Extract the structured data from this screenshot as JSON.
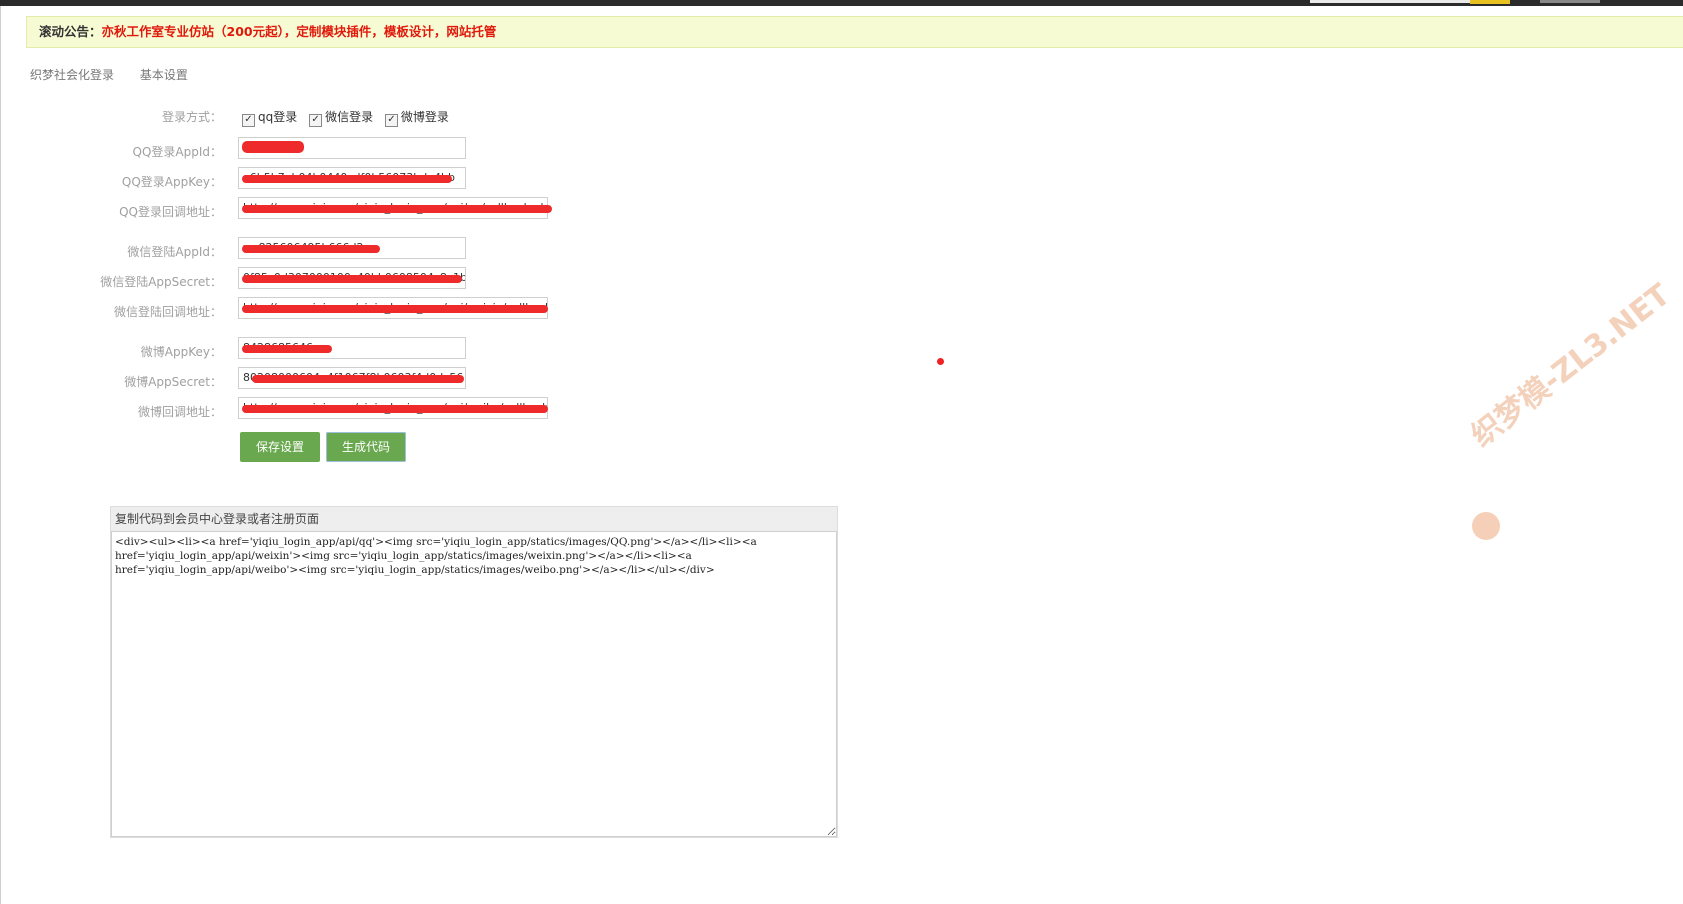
{
  "notice": {
    "label": "滚动公告：",
    "message": "亦秋工作室专业仿站（200元起），定制模块插件，模板设计，网站托管"
  },
  "tabs": [
    "织梦社会化登录",
    "基本设置"
  ],
  "login_method": {
    "label": "登录方式：",
    "options": [
      {
        "label": "qq登录",
        "checked": true
      },
      {
        "label": "微信登录",
        "checked": true
      },
      {
        "label": "微博登录",
        "checked": true
      }
    ]
  },
  "fields": [
    {
      "label": "QQ登录AppId：",
      "value": "d"
    },
    {
      "label": "QQ登录AppKey：",
      "value": "a6b5b7eb04b0440cdf0b56073bde4bb"
    },
    {
      "label": "QQ登录回调地址：",
      "value": "http://www.yiqiu.org/yiqiu_login_app/api/qq/callback.ph"
    },
    {
      "label": "微信登陆AppId：",
      "value": "wx825606495b666d2"
    },
    {
      "label": "微信登陆AppSecret：",
      "value": "0f85c0d307000100c40bb0608504c8c1b"
    },
    {
      "label": "微信登陆回调地址：",
      "value": "http://www.yiqiu.org/yiqiu_login_app/api/weixin/callback"
    },
    {
      "label": "微博AppKey：",
      "value": "8428685646"
    },
    {
      "label": "微博AppSecret：",
      "value": "80208000604a4f1067f8b0603f4d0dc56"
    },
    {
      "label": "微博回调地址：",
      "value": "http://www.yiqiu.org/yiqiu_login_app/api/weibo/callback"
    }
  ],
  "buttons": {
    "save": "保存设置",
    "generate": "生成代码"
  },
  "code": {
    "header": "复制代码到会员中心登录或者注册页面",
    "content": "<div><ul><li><a href='yiqiu_login_app/api/qq'><img src='yiqiu_login_app/statics/images/QQ.png'></a></li><li><a href='yiqiu_login_app/api/weixin'><img src='yiqiu_login_app/statics/images/weixin.png'></a></li><li><a href='yiqiu_login_app/api/weibo'><img src='yiqiu_login_app/statics/images/weibo.png'></a></li></ul></div>"
  },
  "watermark": "织梦模-ZL3.NET",
  "colors": {
    "button": "#6aa84f",
    "notice_bg": "#f7fbd4",
    "notice_text": "#e0190b",
    "redaction": "#ee2a2a"
  }
}
